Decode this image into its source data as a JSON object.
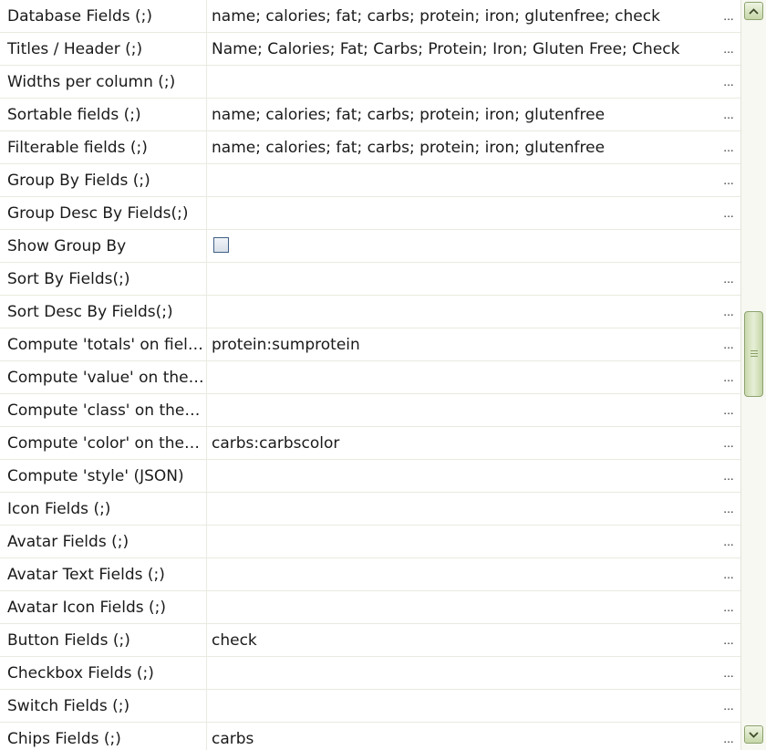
{
  "properties": [
    {
      "label": "Database Fields (;)",
      "value": "name; calories; fat; carbs; protein; iron; glutenfree; check",
      "type": "text"
    },
    {
      "label": "Titles / Header (;)",
      "value": "Name; Calories; Fat; Carbs; Protein; Iron; Gluten Free; Check",
      "type": "text"
    },
    {
      "label": "Widths per column (;)",
      "value": "",
      "type": "text"
    },
    {
      "label": "Sortable fields (;)",
      "value": "name; calories; fat; carbs; protein; iron; glutenfree",
      "type": "text"
    },
    {
      "label": "Filterable fields (;)",
      "value": "name; calories; fat; carbs; protein; iron; glutenfree",
      "type": "text"
    },
    {
      "label": "Group By Fields (;)",
      "value": "",
      "type": "text"
    },
    {
      "label": "Group Desc By Fields(;)",
      "value": "",
      "type": "text"
    },
    {
      "label": "Show Group By",
      "value": "",
      "type": "checkbox",
      "checked": false
    },
    {
      "label": "Sort By Fields(;)",
      "value": "",
      "type": "text"
    },
    {
      "label": "Sort Desc By Fields(;)",
      "value": "",
      "type": "text"
    },
    {
      "label": "Compute 'totals' on field...",
      "value": "protein:sumprotein",
      "type": "text"
    },
    {
      "label": "Compute 'value' on these...",
      "value": "",
      "type": "text"
    },
    {
      "label": "Compute 'class' on these...",
      "value": "",
      "type": "text"
    },
    {
      "label": "Compute 'color' on these...",
      "value": "carbs:carbscolor",
      "type": "text"
    },
    {
      "label": "Compute 'style' (JSON)",
      "value": "",
      "type": "text"
    },
    {
      "label": "Icon Fields (;)",
      "value": "",
      "type": "text"
    },
    {
      "label": "Avatar Fields (;)",
      "value": "",
      "type": "text"
    },
    {
      "label": "Avatar Text Fields (;)",
      "value": "",
      "type": "text"
    },
    {
      "label": "Avatar Icon Fields (;)",
      "value": "",
      "type": "text"
    },
    {
      "label": "Button Fields (;)",
      "value": "check",
      "type": "text"
    },
    {
      "label": "Checkbox Fields (;)",
      "value": "",
      "type": "text"
    },
    {
      "label": "Switch Fields (;)",
      "value": "",
      "type": "text"
    },
    {
      "label": "Chips Fields (;)",
      "value": "carbs",
      "type": "text"
    }
  ],
  "ellipsis_label": "...",
  "scrollbar": {
    "position_fraction": 0.47
  },
  "colors": {
    "grid_line": "#e8ebe0",
    "scroll_accent": "#c6d7a8"
  }
}
